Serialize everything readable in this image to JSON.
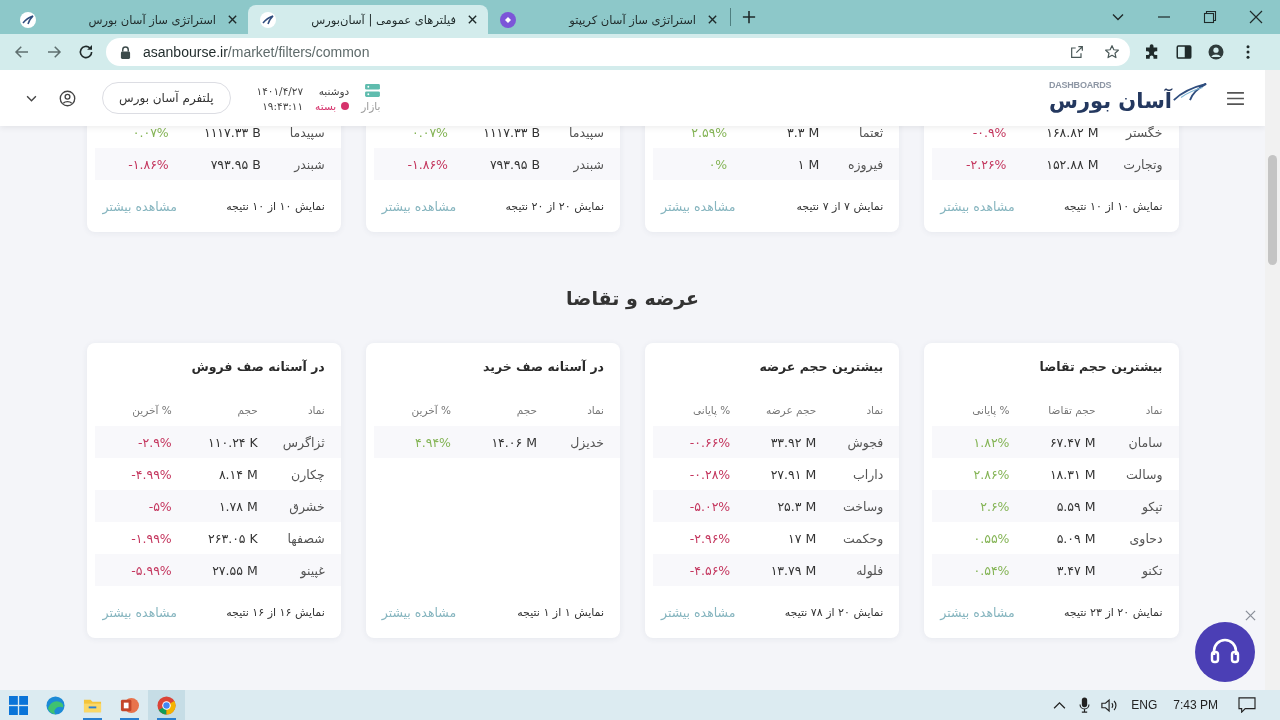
{
  "browser": {
    "tabs": [
      {
        "title": "استراتژی ساز آسان کریپتو",
        "kind": "badge",
        "selected": false
      },
      {
        "title": "فیلترهای عمومی | آسان‌بورس",
        "kind": "logo",
        "selected": true
      },
      {
        "title": "استراتژی ساز آسان بورس",
        "kind": "logo",
        "selected": false
      }
    ],
    "address": {
      "host": "asanbourse.ir",
      "path": "/market/filters/common"
    }
  },
  "header": {
    "logo": {
      "wordmark": "آسان بورس",
      "tagline": "DASHBOARDS"
    },
    "weekday": "دوشنبه",
    "date": "۱۴۰۱/۴/۲۷",
    "market": {
      "label": "بازار",
      "status": "بسته",
      "open": false,
      "time": "۱۹:۴۳:۱۱"
    },
    "platform_button": "پلتفرم آسان بورس"
  },
  "top_cards": [
    {
      "rows": [
        {
          "symbol": "خگستر",
          "volume": "۱۶۸.۸۲ M",
          "change": "-۰.۹%",
          "positive": false
        },
        {
          "symbol": "وتجارت",
          "volume": "۱۵۲.۸۸ M",
          "change": "-۲.۲۶%",
          "positive": false
        }
      ],
      "summary": "نمایش ۱۰ از ۱۰ نتیجه",
      "more": "مشاهده بیشتر"
    },
    {
      "rows": [
        {
          "symbol": "ثعتما",
          "volume": "۳.۳ M",
          "change": "۲.۵۹%",
          "positive": true
        },
        {
          "symbol": "فیروزه",
          "volume": "۱ M",
          "change": "۰%",
          "positive": true
        }
      ],
      "summary": "نمایش ۷ از ۷ نتیجه",
      "more": "مشاهده بیشتر"
    },
    {
      "rows": [
        {
          "symbol": "سپیدما",
          "volume": "۱۱۱۷.۳۳ B",
          "change": "۰.۰۷%",
          "positive": true
        },
        {
          "symbol": "شبندر",
          "volume": "۷۹۳.۹۵ B",
          "change": "-۱.۸۶%",
          "positive": false
        }
      ],
      "summary": "نمایش ۲۰ از ۲۰ نتیجه",
      "more": "مشاهده بیشتر"
    },
    {
      "rows": [
        {
          "symbol": "سپیدما",
          "volume": "۱۱۱۷.۳۳ B",
          "change": "۰.۰۷%",
          "positive": true
        },
        {
          "symbol": "شبندر",
          "volume": "۷۹۳.۹۵ B",
          "change": "-۱.۸۶%",
          "positive": false
        }
      ],
      "summary": "نمایش ۱۰ از ۱۰ نتیجه",
      "more": "مشاهده بیشتر"
    }
  ],
  "supply_demand": {
    "title": "عرضه و تقاضا",
    "cards": [
      {
        "title": "بیشترین حجم تقاضا",
        "columns": [
          "نماد",
          "حجم تقاضا",
          "% پایانی"
        ],
        "rows": [
          {
            "symbol": "سامان",
            "volume": "۶۷.۴۷ M",
            "change": "۱.۸۲%",
            "positive": true
          },
          {
            "symbol": "وسالت",
            "volume": "۱۸.۳۱ M",
            "change": "۲.۸۶%",
            "positive": true
          },
          {
            "symbol": "تپکو",
            "volume": "۵.۵۹ M",
            "change": "۲.۶%",
            "positive": true
          },
          {
            "symbol": "دحاوی",
            "volume": "۵.۰۹ M",
            "change": "۰.۵۵%",
            "positive": true
          },
          {
            "symbol": "تکنو",
            "volume": "۳.۴۷ M",
            "change": "۰.۵۴%",
            "positive": true
          }
        ],
        "summary": "نمایش ۲۰ از ۲۳ نتیجه",
        "more": "مشاهده بیشتر"
      },
      {
        "title": "بیشترین حجم عرضه",
        "columns": [
          "نماد",
          "حجم عرضه",
          "% پایانی"
        ],
        "rows": [
          {
            "symbol": "فجوش",
            "volume": "۳۳.۹۲ M",
            "change": "-۰.۶۶%",
            "positive": false
          },
          {
            "symbol": "داراب",
            "volume": "۲۷.۹۱ M",
            "change": "-۰.۲۸%",
            "positive": false
          },
          {
            "symbol": "وساخت",
            "volume": "۲۵.۳ M",
            "change": "-۵.۰۲%",
            "positive": false
          },
          {
            "symbol": "وحکمت",
            "volume": "۱۷ M",
            "change": "-۲.۹۶%",
            "positive": false
          },
          {
            "symbol": "فلوله",
            "volume": "۱۳.۷۹ M",
            "change": "-۴.۵۶%",
            "positive": false
          }
        ],
        "summary": "نمایش ۲۰ از ۷۸ نتیجه",
        "more": "مشاهده بیشتر"
      },
      {
        "title": "در آستانه صف خرید",
        "columns": [
          "نماد",
          "حجم",
          "% آخرین"
        ],
        "rows": [
          {
            "symbol": "خدیزل",
            "volume": "۱۴.۰۶ M",
            "change": "۴.۹۴%",
            "positive": true
          }
        ],
        "summary": "نمایش ۱ از ۱ نتیجه",
        "more": "مشاهده بیشتر"
      },
      {
        "title": "در آستانه صف فروش",
        "columns": [
          "نماد",
          "حجم",
          "% آخرین"
        ],
        "rows": [
          {
            "symbol": "ثزاگرس",
            "volume": "۱۱۰.۲۴ K",
            "change": "-۲.۹%",
            "positive": false
          },
          {
            "symbol": "چکارن",
            "volume": "۸.۱۴ M",
            "change": "-۴.۹۹%",
            "positive": false
          },
          {
            "symbol": "خشرق",
            "volume": "۱.۷۸ M",
            "change": "-۵%",
            "positive": false
          },
          {
            "symbol": "شصفها",
            "volume": "۲۶۳.۰۵ K",
            "change": "-۱.۹۹%",
            "positive": false
          },
          {
            "symbol": "غپینو",
            "volume": "۲۷.۵۵ M",
            "change": "-۵.۹۹%",
            "positive": false
          }
        ],
        "summary": "نمایش ۱۶ از ۱۶ نتیجه",
        "more": "مشاهده بیشتر"
      }
    ]
  },
  "taskbar": {
    "apps": [
      {
        "kind": "swirl",
        "running": false,
        "selected": false
      },
      {
        "kind": "folder",
        "running": true,
        "selected": false
      },
      {
        "kind": "slides",
        "running": true,
        "selected": false
      },
      {
        "kind": "wheel",
        "running": true,
        "selected": true
      }
    ],
    "language": "ENG",
    "time": "7:43 PM"
  }
}
